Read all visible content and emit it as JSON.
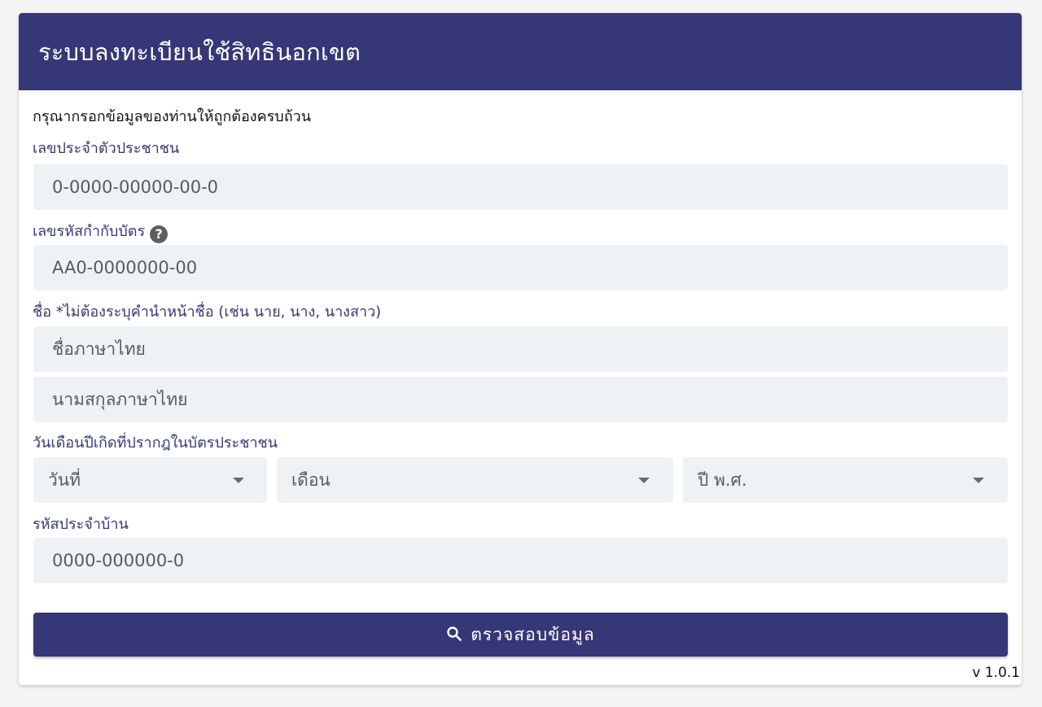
{
  "header": {
    "title": "ระบบลงทะเบียนใช้สิทธินอกเขต"
  },
  "form": {
    "instruction": "กรุณากรอกข้อมูลของท่านให้ถูกต้องครบถ้วน",
    "citizen_id": {
      "label": "เลขประจำตัวประชาชน",
      "placeholder": "0-0000-00000-00-0",
      "value": ""
    },
    "laser_code": {
      "label": "เลขรหัสกำกับบัตร",
      "help_icon": "?",
      "placeholder": "AA0-0000000-00",
      "value": ""
    },
    "name": {
      "label": "ชื่อ *ไม่ต้องระบุคำนำหน้าชื่อ (เช่น นาย, นาง, นางสาว)",
      "first_name_placeholder": "ชื่อภาษาไทย",
      "last_name_placeholder": "นามสกุลภาษาไทย"
    },
    "birth_date": {
      "label": "วันเดือนปีเกิดที่ปรากฎในบัตรประชาชน",
      "day": "วันที่",
      "month": "เดือน",
      "year": "ปี พ.ศ."
    },
    "house_code": {
      "label": "รหัสประจำบ้าน",
      "placeholder": "0000-000000-0",
      "value": ""
    },
    "submit_label": "ตรวจสอบข้อมูล"
  },
  "version": "v 1.0.1",
  "colors": {
    "primary": "#363776",
    "input_background": "#eff2f5",
    "page_background": "#f5f5f5"
  }
}
